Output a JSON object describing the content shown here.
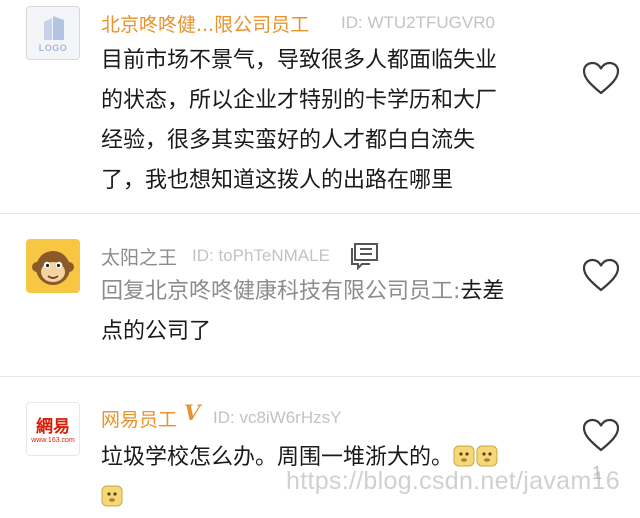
{
  "comments": [
    {
      "avatar_label": "LOGO",
      "avatar_icon": "logo-placeholder-icon",
      "name": "北京咚咚健...限公司员工",
      "uid": "ID: WTU2TFUGVR0",
      "name_color": "#e8932b",
      "content_lines": [
        "目前市场不景气，导致很多人都面临失业",
        "的状态，所以企业才特别的卡学历和大厂",
        "经验，很多其实蛮好的人才都白白流失",
        "了，我也想知道这拨人的出路在哪里"
      ]
    },
    {
      "avatar_icon": "monkey-avatar-icon",
      "name": "太阳之王",
      "uid": "ID: toPhTeNMALE",
      "name_color": "#8c8c8c",
      "has_message_icon": true,
      "reply_lines": [
        "回复北京咚咚健康科技有限公司员工:",
        "点的公司了"
      ],
      "reply_tail": "去差"
    },
    {
      "avatar_main": "網易",
      "avatar_sub": "www.163.com",
      "name": "网易员工",
      "badge": "V",
      "uid": "ID: vc8iW6rHzsY",
      "name_color": "#e8932b",
      "content": "垃圾学校怎么办。周围一堆浙大的。",
      "emoji_icon": "doge-emoji-icon"
    }
  ],
  "watermark": "https://blog.csdn.net/javam16",
  "visible_count": "1",
  "colors": {
    "orange": "#e8932b",
    "gray_text": "#8c8c8c",
    "divider": "#e6e6e6"
  }
}
